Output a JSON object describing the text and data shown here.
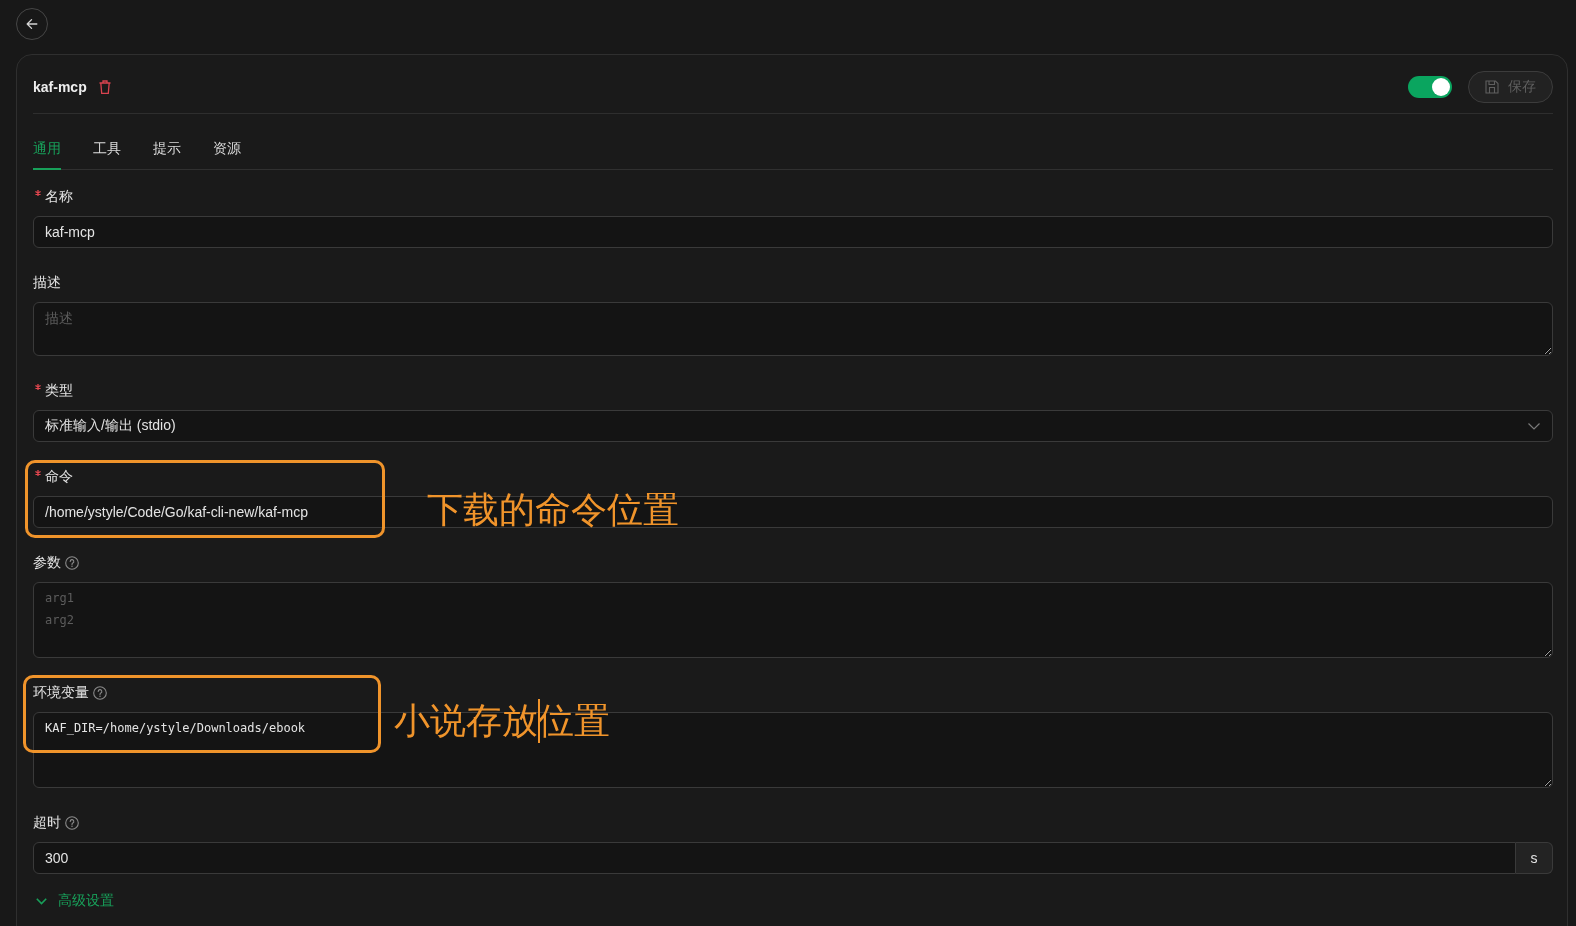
{
  "server": {
    "name": "kaf-mcp",
    "enabled": true
  },
  "save_button": {
    "label": "保存",
    "disabled": true
  },
  "tabs": [
    {
      "label": "通用",
      "selected": true
    },
    {
      "label": "工具",
      "selected": false
    },
    {
      "label": "提示",
      "selected": false
    },
    {
      "label": "资源",
      "selected": false
    }
  ],
  "fields": [
    {
      "kind": "input",
      "label": "名称",
      "required": true,
      "help": false,
      "value": "kaf-mcp"
    },
    {
      "kind": "textarea",
      "label": "描述",
      "required": false,
      "help": false,
      "mono": false,
      "placeholder": "描述"
    },
    {
      "kind": "select",
      "label": "类型",
      "required": true,
      "help": false,
      "value": "标准输入/输出 (stdio)"
    },
    {
      "kind": "input",
      "label": "命令",
      "required": true,
      "help": false,
      "value": "/home/ystyle/Code/Go/kaf-cli-new/kaf-mcp",
      "callout": {
        "text": "下载的命令位置",
        "cursor": false
      }
    },
    {
      "kind": "textarea",
      "label": "参数",
      "required": false,
      "help": true,
      "mono": true,
      "placeholder": "arg1\narg2"
    },
    {
      "kind": "textarea",
      "label": "环境变量",
      "required": false,
      "help": true,
      "mono": true,
      "value": "KAF_DIR=/home/ystyle/Downloads/ebook",
      "callout": {
        "text": "小说存放位置",
        "cursor": true
      }
    },
    {
      "kind": "input_addon",
      "label": "超时",
      "required": false,
      "help": true,
      "value": "300",
      "addon": "s"
    }
  ],
  "advanced": {
    "label": "高级设置"
  }
}
